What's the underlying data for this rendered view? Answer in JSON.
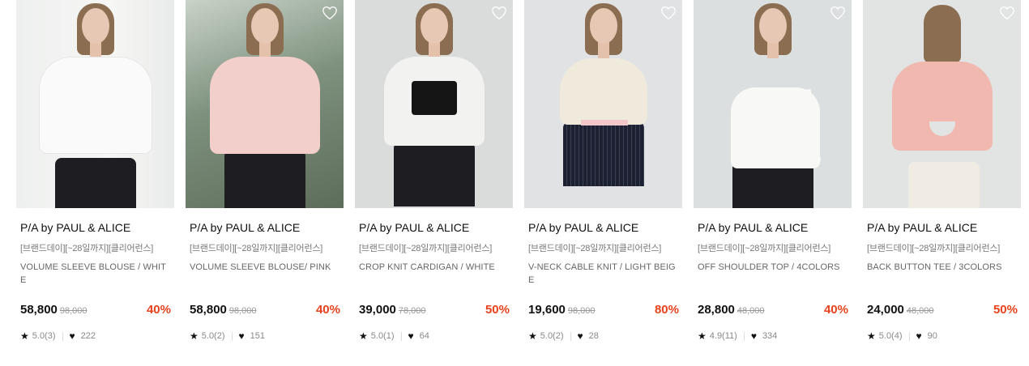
{
  "colors": {
    "discount": "#e8421d"
  },
  "products": [
    {
      "brand": "P/A by PAUL & ALICE",
      "promo": "[브랜드데이][~28일까지][클리어런스]",
      "name": "VOLUME SLEEVE BLOUSE / WHITE",
      "price": "58,800",
      "original_price": "98,000",
      "discount": "40%",
      "rating": "5.0(3)",
      "likes": "222"
    },
    {
      "brand": "P/A by PAUL & ALICE",
      "promo": "[브랜드데이][~28일까지][클리어런스]",
      "name": "VOLUME SLEEVE BLOUSE/ PINK",
      "price": "58,800",
      "original_price": "98,000",
      "discount": "40%",
      "rating": "5.0(2)",
      "likes": "151"
    },
    {
      "brand": "P/A by PAUL & ALICE",
      "promo": "[브랜드데이][~28일까지][클리어런스]",
      "name": "CROP KNIT CARDIGAN / WHITE",
      "price": "39,000",
      "original_price": "78,000",
      "discount": "50%",
      "rating": "5.0(1)",
      "likes": "64"
    },
    {
      "brand": "P/A by PAUL & ALICE",
      "promo": "[브랜드데이][~28일까지][클리어런스]",
      "name": "V-NECK CABLE KNIT / LIGHT BEIGE",
      "price": "19,600",
      "original_price": "98,000",
      "discount": "80%",
      "rating": "5.0(2)",
      "likes": "28"
    },
    {
      "brand": "P/A by PAUL & ALICE",
      "promo": "[브랜드데이][~28일까지][클리어런스]",
      "name": "OFF SHOULDER TOP / 4COLORS",
      "price": "28,800",
      "original_price": "48,000",
      "discount": "40%",
      "rating": "4.9(11)",
      "likes": "334"
    },
    {
      "brand": "P/A by PAUL & ALICE",
      "promo": "[브랜드데이][~28일까지][클리어런스]",
      "name": "BACK BUTTON TEE / 3COLORS",
      "price": "24,000",
      "original_price": "48,000",
      "discount": "50%",
      "rating": "5.0(4)",
      "likes": "90"
    }
  ]
}
